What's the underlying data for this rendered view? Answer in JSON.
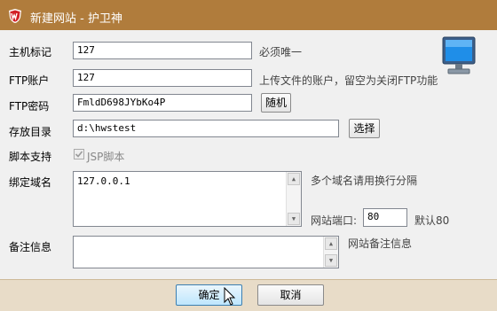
{
  "window": {
    "title": "新建网站 - 护卫神"
  },
  "form": {
    "host": {
      "label": "主机标记",
      "value": "127",
      "hint": "必须唯一"
    },
    "ftp_account": {
      "label": "FTP账户",
      "value": "127",
      "hint": "上传文件的账户，留空为关闭FTP功能"
    },
    "ftp_password": {
      "label": "FTP密码",
      "value": "FmldD698JYbKo4P",
      "random_button": "随机"
    },
    "directory": {
      "label": "存放目录",
      "value": "d:\\hwstest",
      "choose_button": "选择"
    },
    "script": {
      "label": "脚本支持",
      "option": "JSP脚本",
      "checked": true
    },
    "domain": {
      "label": "绑定域名",
      "value": "127.0.0.1",
      "hint": "多个域名请用换行分隔"
    },
    "port": {
      "label": "网站端口:",
      "value": "80",
      "hint": "默认80"
    },
    "remarks": {
      "label": "备注信息",
      "value": "",
      "hint": "网站备注信息"
    }
  },
  "footer": {
    "ok": "确定",
    "cancel": "取消"
  },
  "icons": {
    "app": "wang-logo-icon",
    "monitor": "monitor-icon",
    "cursor": "mouse-cursor-icon"
  },
  "colors": {
    "titlebar": "#b07c3c",
    "footer": "#e8dcc8",
    "logo": "#d21f26"
  }
}
